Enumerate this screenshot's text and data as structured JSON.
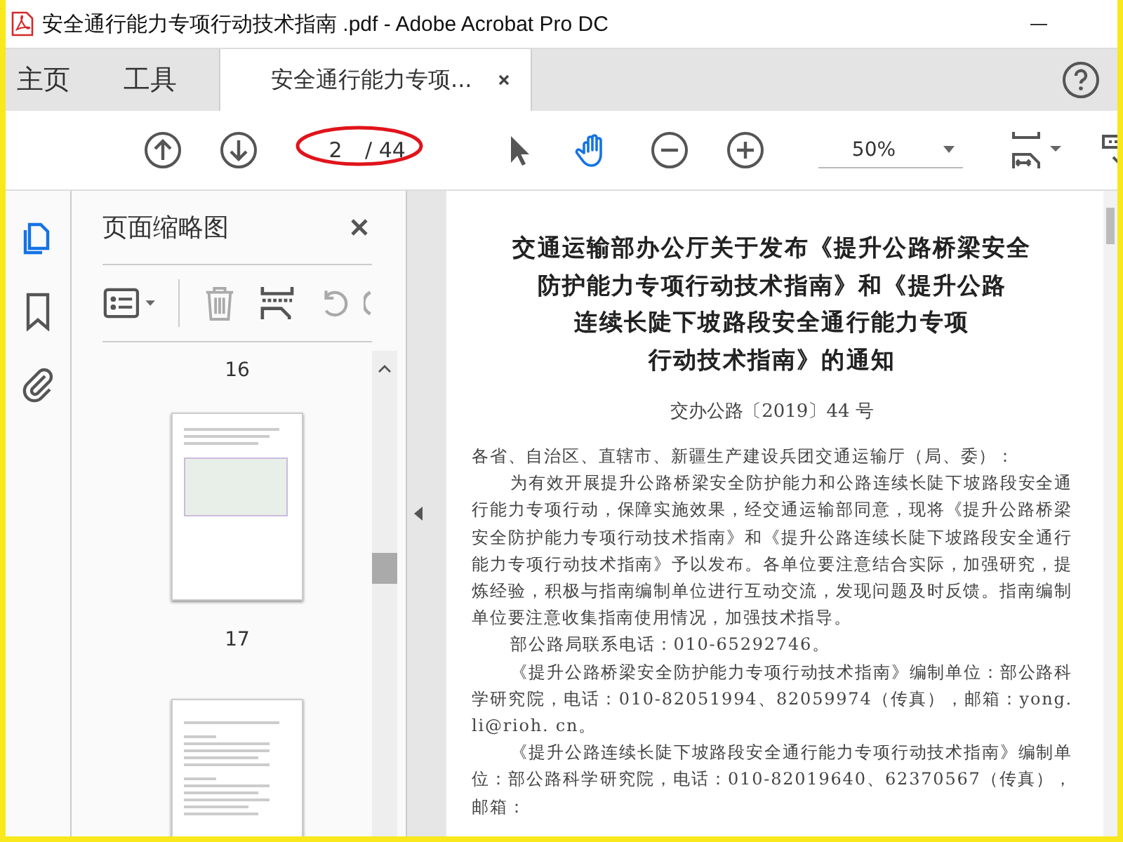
{
  "window": {
    "title": "安全通行能力专项行动技术指南 .pdf - Adobe Acrobat Pro DC"
  },
  "nav_tabs": [
    {
      "label": "主页",
      "selected": false
    },
    {
      "label": "工具",
      "selected": false
    }
  ],
  "document_tab": {
    "label": "安全通行能力专项...",
    "selected": true
  },
  "toolbar": {
    "page_number": "2",
    "page_count": "/ 44",
    "zoom": "50%",
    "tools": [
      {
        "kind": "select",
        "selected": false
      },
      {
        "kind": "hand",
        "selected": true
      }
    ]
  },
  "side_rail": [
    {
      "kind": "pages",
      "selected": true
    },
    {
      "kind": "bookmark",
      "selected": false
    },
    {
      "kind": "attachment",
      "selected": false
    }
  ],
  "thumbnails_panel": {
    "title": "页面缩略图",
    "labels": [
      "16",
      "17"
    ]
  },
  "document": {
    "heading": [
      "交通运输部办公厅关于发布《提升公路桥梁安全",
      "防护能力专项行动技术指南》和《提升公路",
      "连续长陡下坡路段安全通行能力专项",
      "行动技术指南》的通知"
    ],
    "doc_number": "交办公路〔2019〕44 号",
    "paragraphs": [
      {
        "kind": "salutation",
        "text": "各省、自治区、直辖市、新疆生产建设兵团交通运输厅（局、委）："
      },
      {
        "kind": "body",
        "text": "为有效开展提升公路桥梁安全防护能力和公路连续长陡下坡路段安全通行能力专项行动，保障实施效果，经交通运输部同意，现将《提升公路桥梁安全防护能力专项行动技术指南》和《提升公路连续长陡下坡路段安全通行能力专项行动技术指南》予以发布。各单位要注意结合实际，加强研究，提炼经验，积极与指南编制单位进行互动交流，发现问题及时反馈。指南编制单位要注意收集指南使用情况，加强技术指导。"
      },
      {
        "kind": "body",
        "text": "部公路局联系电话：010-65292746。"
      },
      {
        "kind": "body",
        "text": "《提升公路桥梁安全防护能力专项行动技术指南》编制单位：部公路科学研究院，电话：010-82051994、82059974（传真），邮箱：yong. li@rioh. cn。"
      },
      {
        "kind": "body",
        "text": "《提升公路连续长陡下坡路段安全通行能力专项行动技术指南》编制单位：部公路科学研究院，电话：010-82019640、62370567（传真），邮箱："
      }
    ]
  }
}
